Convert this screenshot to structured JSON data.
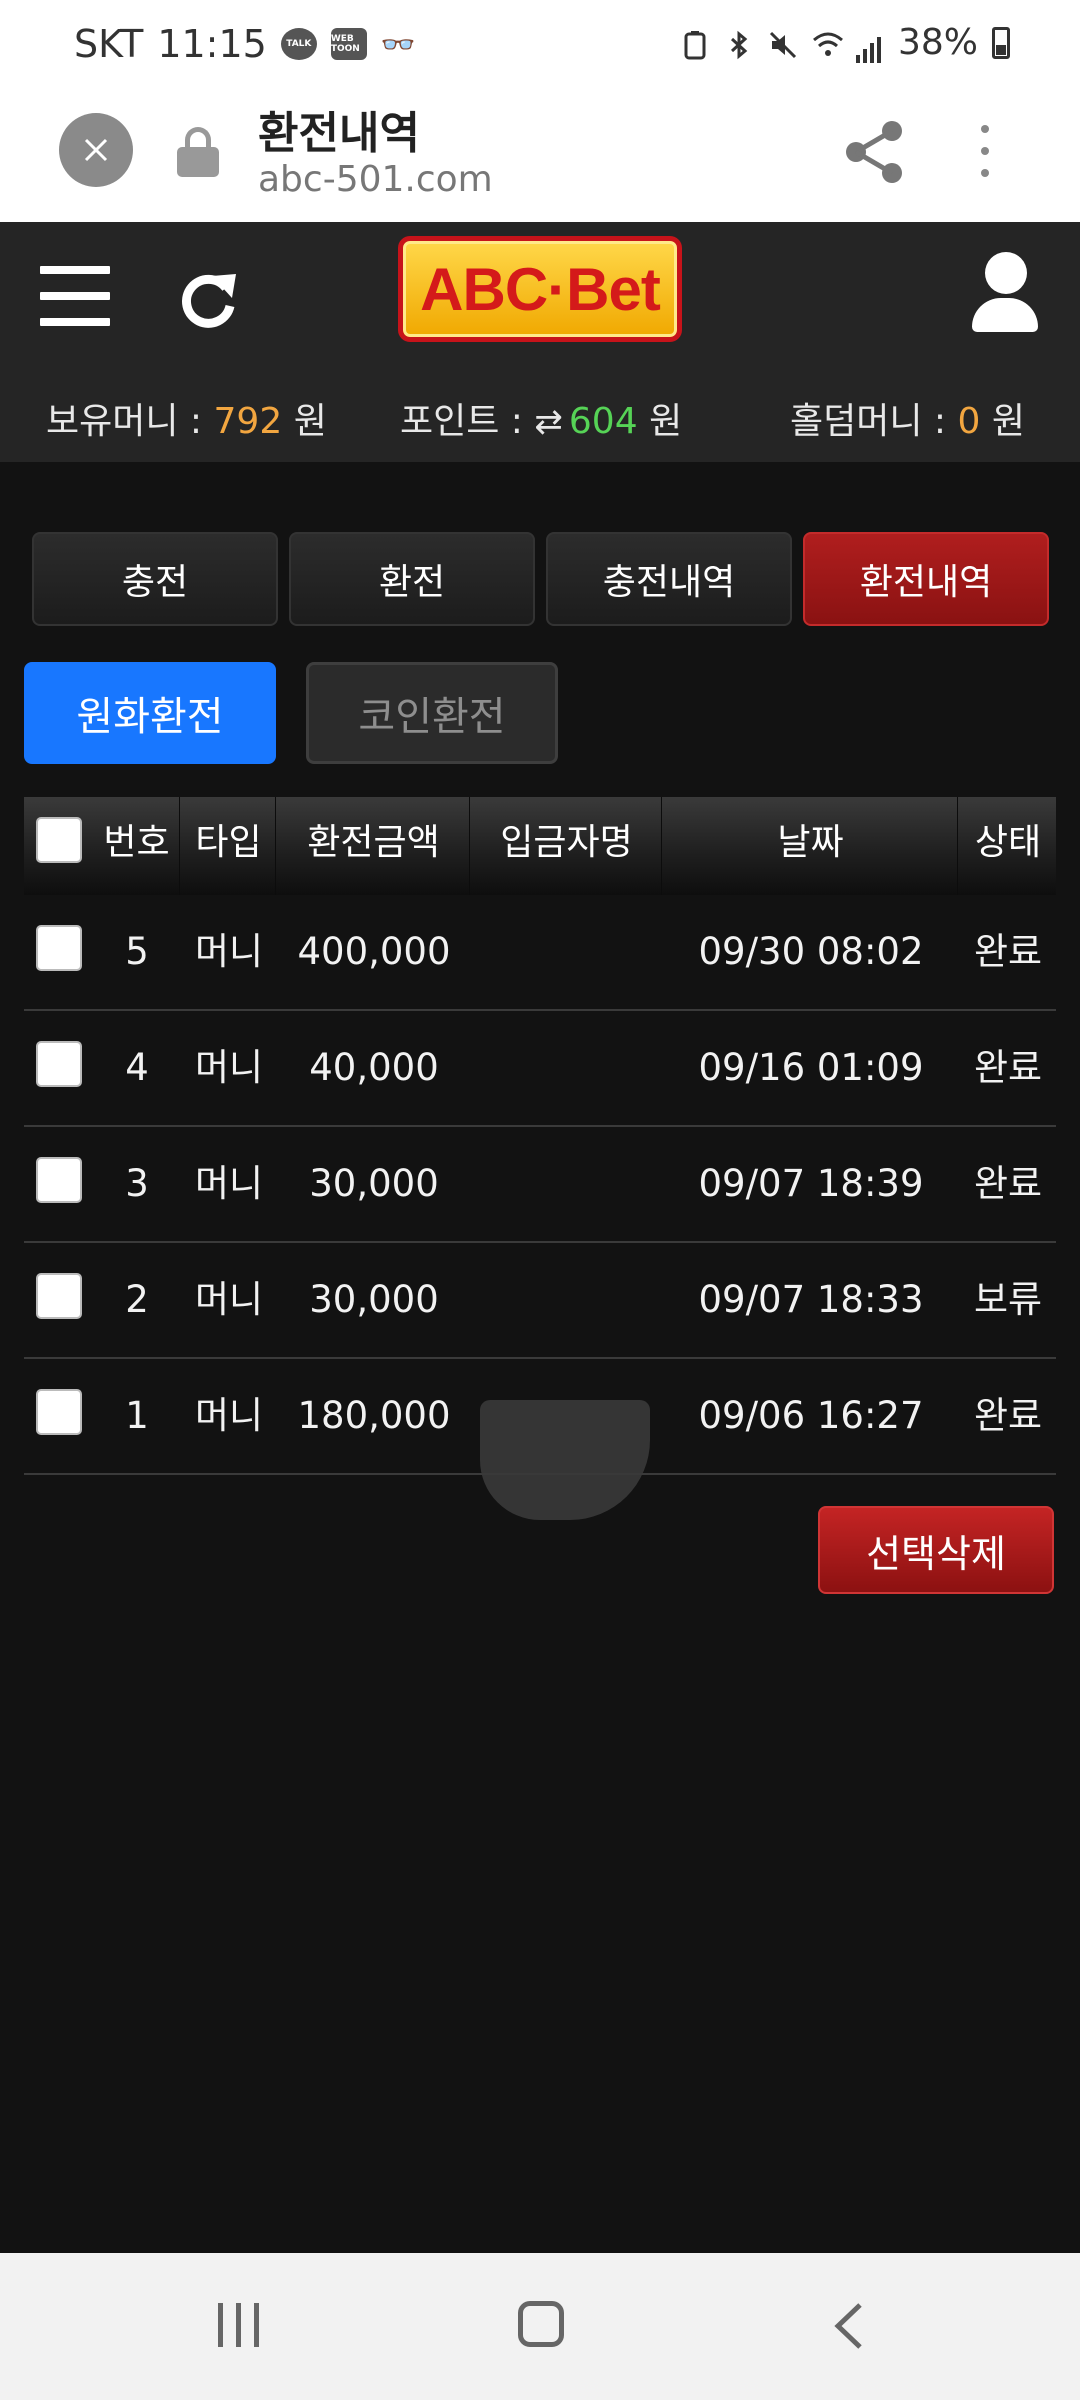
{
  "status_bar": {
    "carrier": "SKT",
    "time": "11:15",
    "apps": [
      "TALK",
      "WEB TOON"
    ],
    "battery": "38%",
    "icons": [
      "battery-saver-icon",
      "bluetooth-icon",
      "mute-icon",
      "wifi-icon",
      "signal-icon",
      "battery-icon"
    ]
  },
  "browser": {
    "title": "환전내역",
    "url": "abc-501.com"
  },
  "header": {
    "logo_text": "ABC·Bet",
    "balance_label": "보유머니 :",
    "balance_value": "792",
    "points_label": "포인트 :",
    "points_value": "604",
    "holdem_label": "홀덤머니 :",
    "holdem_value": "0",
    "currency": "원"
  },
  "tabs": [
    {
      "label": "충전",
      "active": false
    },
    {
      "label": "환전",
      "active": false
    },
    {
      "label": "충전내역",
      "active": false
    },
    {
      "label": "환전내역",
      "active": true
    }
  ],
  "subtabs": [
    {
      "label": "원화환전",
      "active": true
    },
    {
      "label": "코인환전",
      "active": false
    }
  ],
  "table": {
    "columns": [
      "번호",
      "타입",
      "환전금액",
      "입금자명",
      "날짜",
      "상태"
    ],
    "rows": [
      {
        "no": "5",
        "type": "머니",
        "amount": "400,000",
        "depositor": "",
        "date": "09/30 08:02",
        "status": "완료"
      },
      {
        "no": "4",
        "type": "머니",
        "amount": "40,000",
        "depositor": "",
        "date": "09/16 01:09",
        "status": "완료"
      },
      {
        "no": "3",
        "type": "머니",
        "amount": "30,000",
        "depositor": "",
        "date": "09/07 18:39",
        "status": "완료"
      },
      {
        "no": "2",
        "type": "머니",
        "amount": "30,000",
        "depositor": "",
        "date": "09/07 18:33",
        "status": "보류"
      },
      {
        "no": "1",
        "type": "머니",
        "amount": "180,000",
        "depositor": "",
        "date": "09/06 16:27",
        "status": "완료"
      }
    ]
  },
  "delete_button": "선택삭제",
  "colors": {
    "accent_red": "#8a1212",
    "accent_blue": "#1877ff",
    "orange": "#f2a640",
    "green": "#56d356"
  }
}
